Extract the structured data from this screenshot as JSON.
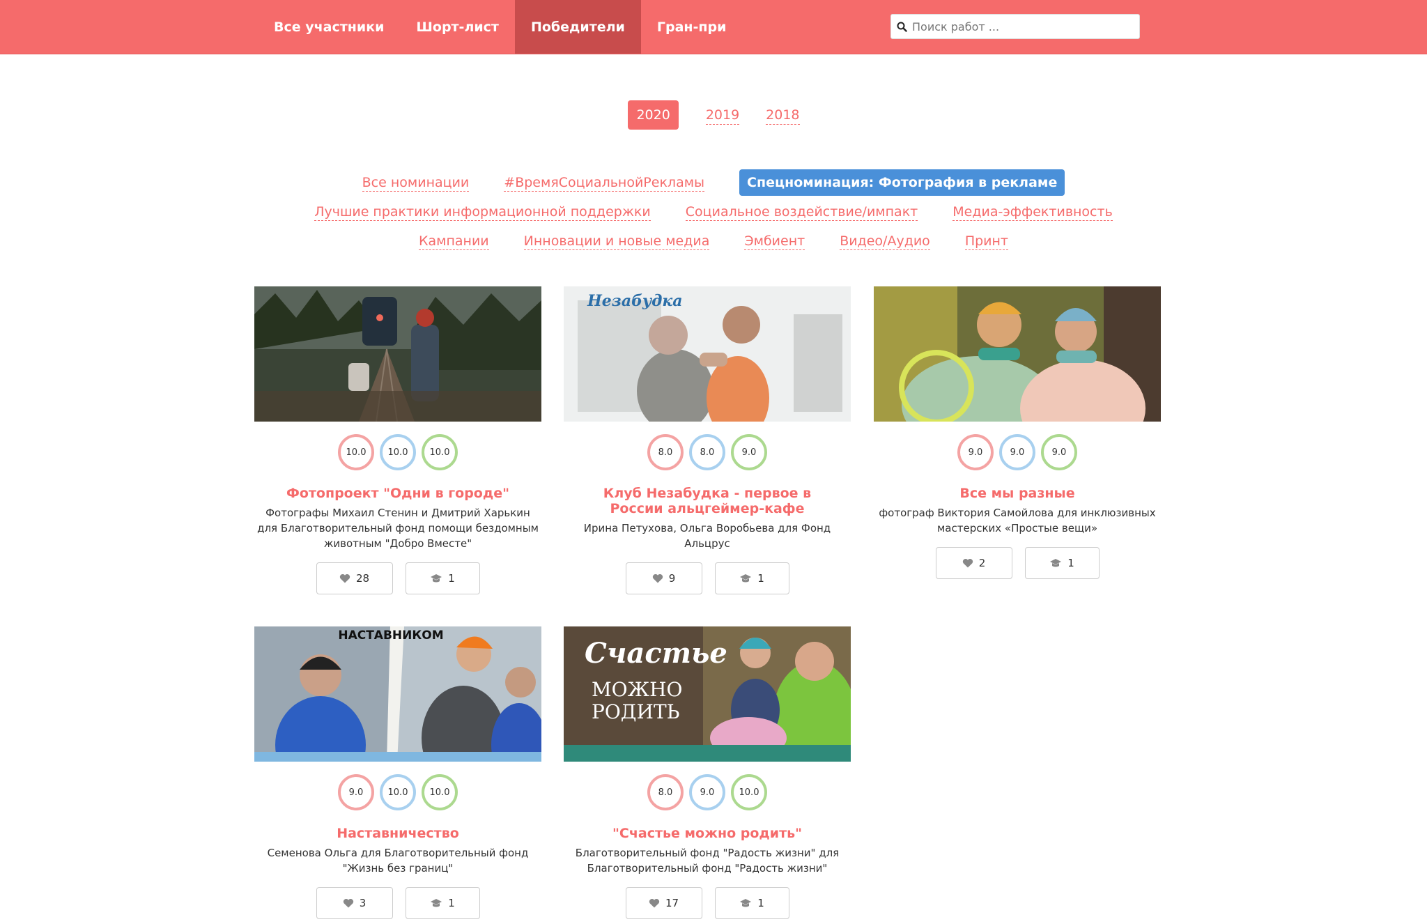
{
  "nav": {
    "items": [
      "Все участники",
      "Шорт-лист",
      "Победители",
      "Гран-при"
    ],
    "active": "Победители"
  },
  "search": {
    "placeholder": "Поиск работ ..."
  },
  "years": [
    "2020",
    "2019",
    "2018"
  ],
  "nominations": {
    "row1": [
      "Все номинации",
      "#ВремяСоциальнойРекламы",
      "Спецноминация: Фотография в рекламе"
    ],
    "row2": [
      "Лучшие практики информационной поддержки",
      "Социальное воздействие/импакт",
      "Медиа-эффективность"
    ],
    "row3": [
      "Кампании",
      "Инновации и новые медиа",
      "Эмбиент",
      "Видео/Аудио",
      "Принт"
    ]
  },
  "colors": {
    "accent": "#f56b6b",
    "active_tab": "#c84c4c",
    "nomination_active": "#4a90d9"
  },
  "cards": [
    {
      "title": "Фотопроект \"Одни в городе\"",
      "description": "Фотографы Михаил Стенин и Дмитрий Харькин для Благотворительный фонд помощи бездомным животным \"Добро Вместе\"",
      "scores": [
        "10.0",
        "10.0",
        "10.0"
      ],
      "likes": "28",
      "votes": "1"
    },
    {
      "title": "Клуб Незабудка - первое в России альцгеймер-кафе",
      "description": "Ирина Петухова, Ольга Воробьева для Фонд Альцрус",
      "image_text": "Незабудка",
      "scores": [
        "8.0",
        "8.0",
        "9.0"
      ],
      "likes": "9",
      "votes": "1"
    },
    {
      "title": "Все мы разные",
      "description": "фотограф Виктория Самойлова для инклюзивных мастерских «Простые вещи»",
      "scores": [
        "9.0",
        "9.0",
        "9.0"
      ],
      "likes": "2",
      "votes": "1"
    },
    {
      "title": "Наставничество",
      "description": "Семенова Ольга для Благотворительный фонд \"Жизнь без границ\"",
      "image_text": "НАСТАВНИКОМ",
      "scores": [
        "9.0",
        "10.0",
        "10.0"
      ],
      "likes": "3",
      "votes": "1"
    },
    {
      "title": "\"Счастье можно родить\"",
      "description": "Благотворительный фонд \"Радость жизни\" для Благотворительный фонд \"Радость жизни\"",
      "image_text": [
        "Счастье",
        "МОЖНО",
        "РОДИТЬ"
      ],
      "scores": [
        "8.0",
        "9.0",
        "10.0"
      ],
      "likes": "17",
      "votes": "1"
    }
  ]
}
